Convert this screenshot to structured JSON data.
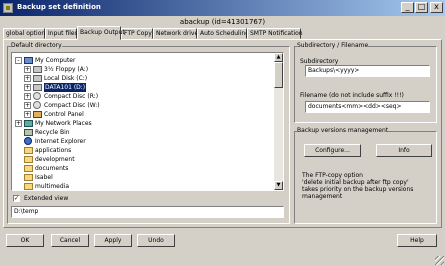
{
  "window": {
    "title": "Backup set definition",
    "header": "abackup (id=41301767)",
    "controls": {
      "minimize": "_",
      "maximize": "□",
      "close": "x"
    }
  },
  "tabs": [
    {
      "label": "global options"
    },
    {
      "label": "Input files"
    },
    {
      "label": "Backup Output"
    },
    {
      "label": "FTP Copy"
    },
    {
      "label": "Network drives"
    },
    {
      "label": "Auto Scheduling"
    },
    {
      "label": "SMTP Notification"
    }
  ],
  "default_directory": {
    "group_label": "Default directory",
    "tree": [
      {
        "label": "My Computer",
        "icon": "computer-icon",
        "toggle": "-"
      },
      {
        "label": "3½ Floppy (A:)",
        "icon": "floppy-icon",
        "toggle": "+"
      },
      {
        "label": "Local Disk (C:)",
        "icon": "drive-icon",
        "toggle": "+"
      },
      {
        "label": "DATA101 (D:)",
        "icon": "drive-icon",
        "toggle": "+",
        "selected": true
      },
      {
        "label": "Compact Disc (R:)",
        "icon": "cd-icon",
        "toggle": "+"
      },
      {
        "label": "Compact Disc (W:)",
        "icon": "cd-icon",
        "toggle": "+"
      },
      {
        "label": "Control Panel",
        "icon": "control-panel-icon",
        "toggle": "+"
      },
      {
        "label": "My Network Places",
        "icon": "network-icon",
        "toggle": "+"
      },
      {
        "label": "Recycle Bin",
        "icon": "recycle-bin-icon",
        "toggle": ""
      },
      {
        "label": "Internet Explorer",
        "icon": "internet-explorer-icon",
        "toggle": ""
      },
      {
        "label": "applications",
        "icon": "folder-icon",
        "toggle": ""
      },
      {
        "label": "development",
        "icon": "folder-icon",
        "toggle": ""
      },
      {
        "label": "documents",
        "icon": "folder-icon",
        "toggle": ""
      },
      {
        "label": "Isabel",
        "icon": "folder-icon",
        "toggle": ""
      },
      {
        "label": "multimedia",
        "icon": "folder-icon",
        "toggle": ""
      }
    ],
    "extended_view_label": "Extended view",
    "extended_view_checked": true,
    "extended_view_mark": "✓",
    "path_value": "D:\\temp"
  },
  "subdirectory": {
    "group_label": "Subdirectory / Filename",
    "subdir_label": "Subdirectory",
    "subdir_value": "Backups\\<yyyy>",
    "filename_label": "Filename (do not include suffix !!!)",
    "filename_value": "documents<mm><dd><seq>"
  },
  "versions": {
    "group_label": "Backup versions management",
    "configure_label": "Configure...",
    "info_label": "Info",
    "note_lines": [
      "The FTP-copy option",
      "'delete initial backup after ftp copy'",
      "takes priority on the backup versions",
      "management"
    ]
  },
  "footer": {
    "ok_label": "OK",
    "cancel_label": "Cancel",
    "apply_label": "Apply",
    "undo_label": "Undo",
    "help_label": "Help"
  }
}
